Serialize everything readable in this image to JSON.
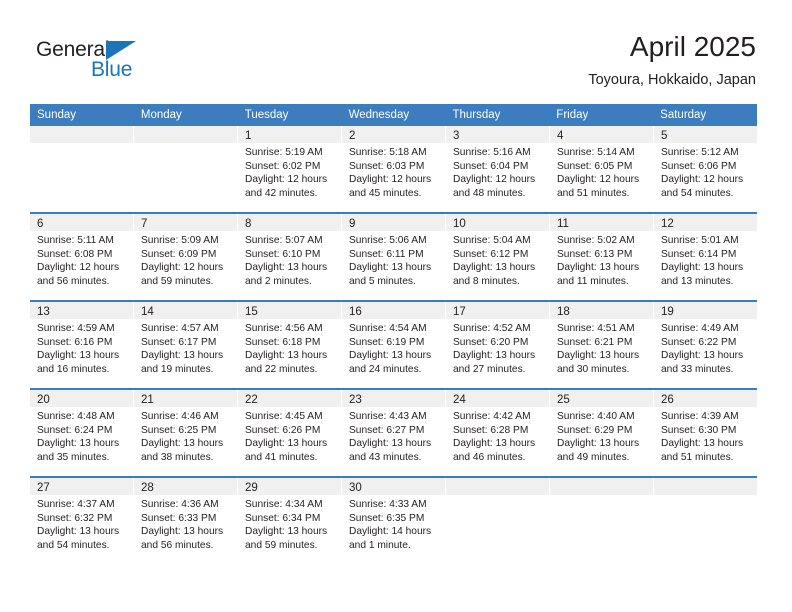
{
  "brand": {
    "name_part1": "General",
    "name_part2": "Blue",
    "triangle_icon": "triangle-icon",
    "color_primary": "#1b75bb",
    "color_text": "#231f20"
  },
  "header": {
    "title": "April 2025",
    "subtitle": "Toyoura, Hokkaido, Japan"
  },
  "calendar": {
    "accent_color": "#3b7dbf",
    "band_color": "#f0f0f0",
    "weekday_headers": [
      "Sunday",
      "Monday",
      "Tuesday",
      "Wednesday",
      "Thursday",
      "Friday",
      "Saturday"
    ],
    "weeks": [
      [
        {
          "day": "",
          "lines": []
        },
        {
          "day": "",
          "lines": []
        },
        {
          "day": "1",
          "lines": [
            "Sunrise: 5:19 AM",
            "Sunset: 6:02 PM",
            "Daylight: 12 hours",
            "and 42 minutes."
          ]
        },
        {
          "day": "2",
          "lines": [
            "Sunrise: 5:18 AM",
            "Sunset: 6:03 PM",
            "Daylight: 12 hours",
            "and 45 minutes."
          ]
        },
        {
          "day": "3",
          "lines": [
            "Sunrise: 5:16 AM",
            "Sunset: 6:04 PM",
            "Daylight: 12 hours",
            "and 48 minutes."
          ]
        },
        {
          "day": "4",
          "lines": [
            "Sunrise: 5:14 AM",
            "Sunset: 6:05 PM",
            "Daylight: 12 hours",
            "and 51 minutes."
          ]
        },
        {
          "day": "5",
          "lines": [
            "Sunrise: 5:12 AM",
            "Sunset: 6:06 PM",
            "Daylight: 12 hours",
            "and 54 minutes."
          ]
        }
      ],
      [
        {
          "day": "6",
          "lines": [
            "Sunrise: 5:11 AM",
            "Sunset: 6:08 PM",
            "Daylight: 12 hours",
            "and 56 minutes."
          ]
        },
        {
          "day": "7",
          "lines": [
            "Sunrise: 5:09 AM",
            "Sunset: 6:09 PM",
            "Daylight: 12 hours",
            "and 59 minutes."
          ]
        },
        {
          "day": "8",
          "lines": [
            "Sunrise: 5:07 AM",
            "Sunset: 6:10 PM",
            "Daylight: 13 hours",
            "and 2 minutes."
          ]
        },
        {
          "day": "9",
          "lines": [
            "Sunrise: 5:06 AM",
            "Sunset: 6:11 PM",
            "Daylight: 13 hours",
            "and 5 minutes."
          ]
        },
        {
          "day": "10",
          "lines": [
            "Sunrise: 5:04 AM",
            "Sunset: 6:12 PM",
            "Daylight: 13 hours",
            "and 8 minutes."
          ]
        },
        {
          "day": "11",
          "lines": [
            "Sunrise: 5:02 AM",
            "Sunset: 6:13 PM",
            "Daylight: 13 hours",
            "and 11 minutes."
          ]
        },
        {
          "day": "12",
          "lines": [
            "Sunrise: 5:01 AM",
            "Sunset: 6:14 PM",
            "Daylight: 13 hours",
            "and 13 minutes."
          ]
        }
      ],
      [
        {
          "day": "13",
          "lines": [
            "Sunrise: 4:59 AM",
            "Sunset: 6:16 PM",
            "Daylight: 13 hours",
            "and 16 minutes."
          ]
        },
        {
          "day": "14",
          "lines": [
            "Sunrise: 4:57 AM",
            "Sunset: 6:17 PM",
            "Daylight: 13 hours",
            "and 19 minutes."
          ]
        },
        {
          "day": "15",
          "lines": [
            "Sunrise: 4:56 AM",
            "Sunset: 6:18 PM",
            "Daylight: 13 hours",
            "and 22 minutes."
          ]
        },
        {
          "day": "16",
          "lines": [
            "Sunrise: 4:54 AM",
            "Sunset: 6:19 PM",
            "Daylight: 13 hours",
            "and 24 minutes."
          ]
        },
        {
          "day": "17",
          "lines": [
            "Sunrise: 4:52 AM",
            "Sunset: 6:20 PM",
            "Daylight: 13 hours",
            "and 27 minutes."
          ]
        },
        {
          "day": "18",
          "lines": [
            "Sunrise: 4:51 AM",
            "Sunset: 6:21 PM",
            "Daylight: 13 hours",
            "and 30 minutes."
          ]
        },
        {
          "day": "19",
          "lines": [
            "Sunrise: 4:49 AM",
            "Sunset: 6:22 PM",
            "Daylight: 13 hours",
            "and 33 minutes."
          ]
        }
      ],
      [
        {
          "day": "20",
          "lines": [
            "Sunrise: 4:48 AM",
            "Sunset: 6:24 PM",
            "Daylight: 13 hours",
            "and 35 minutes."
          ]
        },
        {
          "day": "21",
          "lines": [
            "Sunrise: 4:46 AM",
            "Sunset: 6:25 PM",
            "Daylight: 13 hours",
            "and 38 minutes."
          ]
        },
        {
          "day": "22",
          "lines": [
            "Sunrise: 4:45 AM",
            "Sunset: 6:26 PM",
            "Daylight: 13 hours",
            "and 41 minutes."
          ]
        },
        {
          "day": "23",
          "lines": [
            "Sunrise: 4:43 AM",
            "Sunset: 6:27 PM",
            "Daylight: 13 hours",
            "and 43 minutes."
          ]
        },
        {
          "day": "24",
          "lines": [
            "Sunrise: 4:42 AM",
            "Sunset: 6:28 PM",
            "Daylight: 13 hours",
            "and 46 minutes."
          ]
        },
        {
          "day": "25",
          "lines": [
            "Sunrise: 4:40 AM",
            "Sunset: 6:29 PM",
            "Daylight: 13 hours",
            "and 49 minutes."
          ]
        },
        {
          "day": "26",
          "lines": [
            "Sunrise: 4:39 AM",
            "Sunset: 6:30 PM",
            "Daylight: 13 hours",
            "and 51 minutes."
          ]
        }
      ],
      [
        {
          "day": "27",
          "lines": [
            "Sunrise: 4:37 AM",
            "Sunset: 6:32 PM",
            "Daylight: 13 hours",
            "and 54 minutes."
          ]
        },
        {
          "day": "28",
          "lines": [
            "Sunrise: 4:36 AM",
            "Sunset: 6:33 PM",
            "Daylight: 13 hours",
            "and 56 minutes."
          ]
        },
        {
          "day": "29",
          "lines": [
            "Sunrise: 4:34 AM",
            "Sunset: 6:34 PM",
            "Daylight: 13 hours",
            "and 59 minutes."
          ]
        },
        {
          "day": "30",
          "lines": [
            "Sunrise: 4:33 AM",
            "Sunset: 6:35 PM",
            "Daylight: 14 hours",
            "and 1 minute."
          ]
        },
        {
          "day": "",
          "lines": []
        },
        {
          "day": "",
          "lines": []
        },
        {
          "day": "",
          "lines": []
        }
      ]
    ]
  }
}
